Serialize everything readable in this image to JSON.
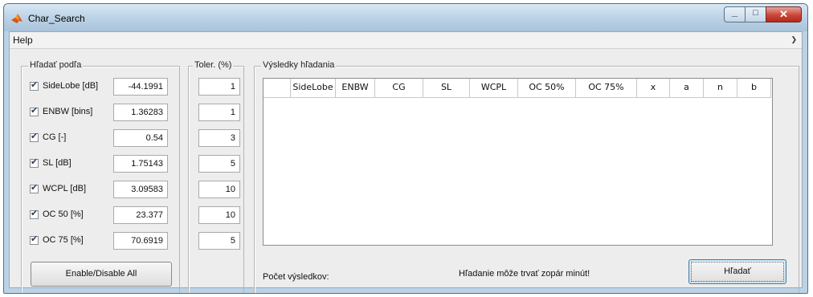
{
  "window": {
    "title": "Char_Search"
  },
  "menu": {
    "items": [
      "Help"
    ]
  },
  "search_panel": {
    "title": "Hľadať podľa",
    "rows": [
      {
        "label": "SideLobe [dB]",
        "checked": true,
        "value": "-44.1991",
        "tolerance": "1"
      },
      {
        "label": "ENBW [bins]",
        "checked": true,
        "value": "1.36283",
        "tolerance": "1"
      },
      {
        "label": "CG [-]",
        "checked": true,
        "value": "0.54",
        "tolerance": "3"
      },
      {
        "label": "SL [dB]",
        "checked": true,
        "value": "1.75143",
        "tolerance": "5"
      },
      {
        "label": "WCPL [dB]",
        "checked": true,
        "value": "3.09583",
        "tolerance": "10"
      },
      {
        "label": "OC 50 [%]",
        "checked": true,
        "value": "23.377",
        "tolerance": "10"
      },
      {
        "label": "OC 75 [%]",
        "checked": true,
        "value": "70.6919",
        "tolerance": "5"
      }
    ],
    "enable_all_label": "Enable/Disable All"
  },
  "tolerance_panel": {
    "title": "Toler. (%)"
  },
  "results_panel": {
    "title": "Výsledky hľadania",
    "columns": [
      "",
      "SideLobe",
      "ENBW",
      "CG",
      "SL",
      "WCPL",
      "OC 50%",
      "OC 75%",
      "x",
      "a",
      "n",
      "b"
    ],
    "result_count_label": "Počet výsledkov:",
    "info_text": "Hľadanie môže trvať zopár minút!",
    "search_button_label": "Hľadať"
  },
  "colors": {
    "title_text": "#000000",
    "checkbox_tick": "#2c3f55",
    "close_button": "#c9463a"
  },
  "icons": {
    "app": "matlab-icon",
    "minimize": "minimize-icon",
    "maximize": "maximize-icon",
    "close": "close-icon",
    "checkbox": "checkmark-icon",
    "menu_overflow": "chevron-right-icon"
  }
}
